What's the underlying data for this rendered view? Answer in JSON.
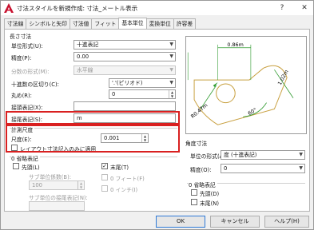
{
  "window": {
    "title": "寸法スタイルを新規作成: 寸法_メートル表示",
    "help_button": "?",
    "close_button": "✕"
  },
  "tabs": [
    "寸法線",
    "シンボルと矢印",
    "寸法値",
    "フィット",
    "基本単位",
    "変換単位",
    "許容差"
  ],
  "linear": {
    "group_title": "長さ寸法",
    "unit_format_label": "単位形式(U):",
    "unit_format_value": "十進表記",
    "precision_label": "精度(P):",
    "precision_value": "0.00",
    "fraction_label": "分数の形式(M):",
    "fraction_value": "水平線",
    "decimal_sep_label": "十進数の区切り(C):",
    "decimal_sep_value": "'.'(ピリオド)",
    "roundoff_label": "丸め(R):",
    "roundoff_value": "0",
    "prefix_label": "接頭表記(X):",
    "prefix_value": "",
    "suffix_label": "接尾表記(S):",
    "suffix_value": "m"
  },
  "scale": {
    "group_title": "計測尺度",
    "factor_label": "尺度(E):",
    "factor_value": "0.001",
    "layout_only_label": "レイアウト寸法記入のみに適用"
  },
  "zero_suppress": {
    "group_title": "0 省略表記",
    "leading_label": "先頭(L)",
    "trailing_label": "末尾(T)",
    "trailing_checked": "✓",
    "sub_factor_label": "サブ単位係数(B):",
    "sub_factor_value": "100",
    "feet_label": "0 フィート(F)",
    "inch_label": "0 インチ(I)",
    "sub_suffix_label": "サブ単位の接尾表記(N):",
    "sub_suffix_value": ""
  },
  "angular": {
    "group_title": "角度寸法",
    "unit_format_label": "単位の形式(A):",
    "unit_format_value": "度 (十進表記)",
    "precision_label": "精度(O):",
    "precision_value": "0",
    "zero_title": "0 省略表記",
    "leading_label": "先頭(D)",
    "trailing_label": "末尾(N)"
  },
  "preview": {
    "dim_top": "0.86m",
    "dim_right": "1.02m",
    "dim_angle": "60°",
    "dim_left": "R0.47m"
  },
  "buttons": {
    "ok": "OK",
    "cancel": "キャンセル",
    "help": "ヘルプ(H)"
  },
  "colors": {
    "highlight_red": "#d92020",
    "app_icon_red": "#c8102e",
    "preview_green": "#2e9a2e",
    "preview_shape": "#c8a040"
  }
}
